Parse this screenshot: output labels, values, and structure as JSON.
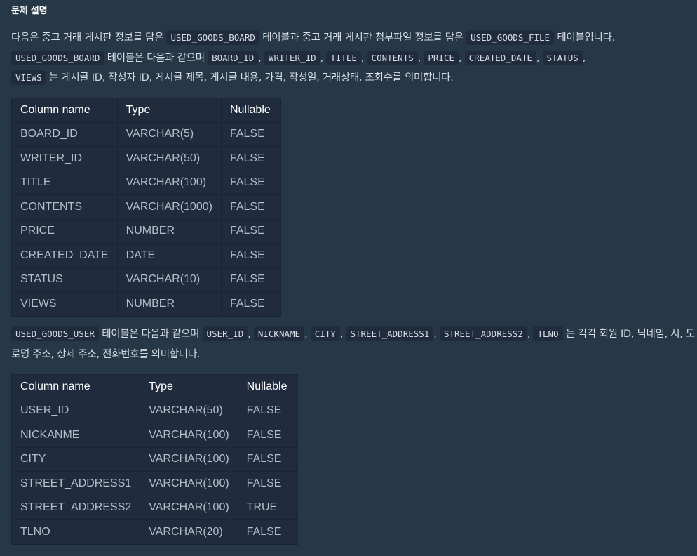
{
  "heading": "문제 설명",
  "para1": {
    "s1": "다음은 중고 거래 게시판 정보를 담은",
    "c1": "USED_GOODS_BOARD",
    "s2": "테이블과 중고 거래 게시판 첨부파일 정보를 담은",
    "c2": "USED_GOODS_FILE",
    "s3": "테이블입니다.",
    "c3": "USED_GOODS_BOARD",
    "s4": "테이블은 다음과 같으며",
    "columns": [
      "BOARD_ID",
      "WRITER_ID",
      "TITLE",
      "CONTENTS",
      "PRICE",
      "CREATED_DATE",
      "STATUS",
      "VIEWS"
    ],
    "separator": ",",
    "s5": "는 게시글 ID, 작성자 ID, 게시글 제목, 게시글 내용, 가격, 작성일, 거래상태, 조회수를 의미합니다."
  },
  "table1": {
    "headers": [
      "Column name",
      "Type",
      "Nullable"
    ],
    "rows": [
      [
        "BOARD_ID",
        "VARCHAR(5)",
        "FALSE"
      ],
      [
        "WRITER_ID",
        "VARCHAR(50)",
        "FALSE"
      ],
      [
        "TITLE",
        "VARCHAR(100)",
        "FALSE"
      ],
      [
        "CONTENTS",
        "VARCHAR(1000)",
        "FALSE"
      ],
      [
        "PRICE",
        "NUMBER",
        "FALSE"
      ],
      [
        "CREATED_DATE",
        "DATE",
        "FALSE"
      ],
      [
        "STATUS",
        "VARCHAR(10)",
        "FALSE"
      ],
      [
        "VIEWS",
        "NUMBER",
        "FALSE"
      ]
    ]
  },
  "para2": {
    "c1": "USED_GOODS_USER",
    "s1": "테이블은 다음과 같으며",
    "columns": [
      "USER_ID",
      "NICKNAME",
      "CITY",
      "STREET_ADDRESS1",
      "STREET_ADDRESS2",
      "TLNO"
    ],
    "separator": ",",
    "s2": "는 각각 회원 ID, 닉네임, 시, 도로명 주소, 상세 주소, 전화번호를 의미합니다."
  },
  "table2": {
    "headers": [
      "Column name",
      "Type",
      "Nullable"
    ],
    "rows": [
      [
        "USER_ID",
        "VARCHAR(50)",
        "FALSE"
      ],
      [
        "NICKANME",
        "VARCHAR(100)",
        "FALSE"
      ],
      [
        "CITY",
        "VARCHAR(100)",
        "FALSE"
      ],
      [
        "STREET_ADDRESS1",
        "VARCHAR(100)",
        "FALSE"
      ],
      [
        "STREET_ADDRESS2",
        "VARCHAR(100)",
        "TRUE"
      ],
      [
        "TLNO",
        "VARCHAR(20)",
        "FALSE"
      ]
    ]
  },
  "colors": {
    "background": "#263747",
    "code_background": "#202b3d",
    "table_background": "#202b3d",
    "text": "#d5dde6",
    "heading_text": "#ffffff",
    "cell_text": "#b4bfcc"
  }
}
